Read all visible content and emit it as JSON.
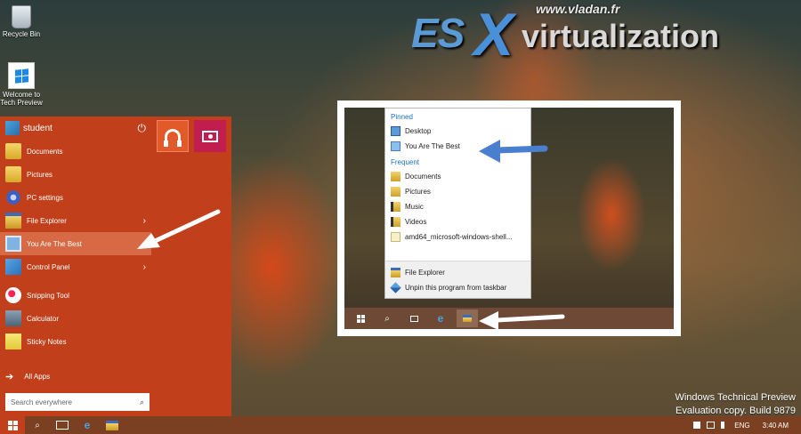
{
  "desktop": {
    "icons": [
      {
        "label": "Recycle Bin",
        "icon": "recycle-bin-icon"
      },
      {
        "label": "Welcome to Tech Preview",
        "icon": "windows-logo-icon"
      }
    ]
  },
  "watermark": {
    "url": "www.vladan.fr",
    "es": "ES",
    "x": "X",
    "rest": "virtualization"
  },
  "start_menu": {
    "user": "student",
    "power_icon": "⏻",
    "items": [
      {
        "label": "Documents",
        "icon": "folder-icon"
      },
      {
        "label": "Pictures",
        "icon": "folder-icon"
      },
      {
        "label": "PC settings",
        "icon": "gear-icon"
      },
      {
        "label": "File Explorer",
        "icon": "file-explorer-icon",
        "chevron": "›"
      },
      {
        "label": "You Are The Best",
        "icon": "app-icon",
        "chevron": "›",
        "selected": true
      },
      {
        "label": "Control Panel",
        "icon": "control-panel-icon",
        "chevron": "›"
      },
      {
        "label": "Snipping Tool",
        "icon": "snipping-tool-icon"
      },
      {
        "label": "Calculator",
        "icon": "calculator-icon"
      },
      {
        "label": "Sticky Notes",
        "icon": "sticky-notes-icon"
      }
    ],
    "all_apps": "All Apps",
    "all_apps_arrow": "➔",
    "search_placeholder": "Search everywhere",
    "search_icon": "⌕",
    "tiles": [
      {
        "name": "music",
        "color": "#e35a2a"
      },
      {
        "name": "video",
        "color": "#c21d4f"
      }
    ],
    "accent": "#c1401b"
  },
  "jumplist": {
    "pinned_header": "Pinned",
    "pinned": [
      {
        "label": "Desktop",
        "icon": "desktop-icon"
      },
      {
        "label": "You Are The Best",
        "icon": "app-icon"
      }
    ],
    "frequent_header": "Frequent",
    "frequent": [
      {
        "label": "Documents",
        "icon": "folder-icon"
      },
      {
        "label": "Pictures",
        "icon": "folder-icon"
      },
      {
        "label": "Music",
        "icon": "music-folder-icon"
      },
      {
        "label": "Videos",
        "icon": "video-folder-icon"
      },
      {
        "label": "amd64_microsoft-windows-shell...",
        "icon": "file-icon"
      }
    ],
    "actions": [
      {
        "label": "File Explorer",
        "icon": "file-explorer-icon"
      },
      {
        "label": "Unpin this program from taskbar",
        "icon": "unpin-icon"
      }
    ]
  },
  "system_text": {
    "line1": "Windows Technical Preview",
    "line2": "Evaluation copy. Build 9879"
  },
  "taskbar": {
    "search_glyph": "⌕",
    "ie_glyph": "e",
    "language": "ENG",
    "time": "3:40 AM",
    "color": "#7b3f22"
  }
}
